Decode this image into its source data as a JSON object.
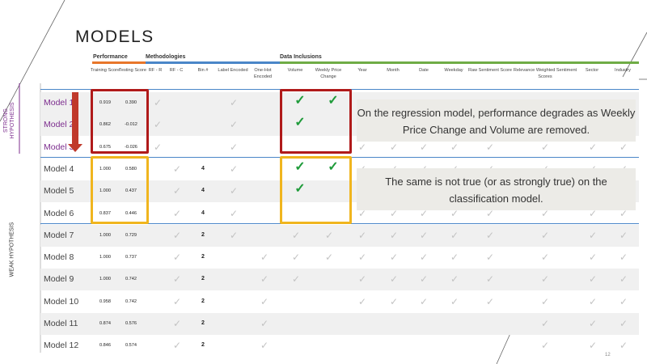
{
  "slide": {
    "title": "MODELS",
    "slide_number": "12",
    "strong_label_line1": "STRONG",
    "strong_label_line2": "HYPOTHESIS",
    "weak_label": "WEAK HYPOTHESIS",
    "callout_top": "On the regression model, performance degrades as Weekly Price Change and Volume are removed.",
    "callout_bottom": "The same is not true (or as strongly true) on the classification model.",
    "colors": {
      "performance": "#e8762b",
      "methodologies": "#4a86c8",
      "data_inclusions": "#6fac46",
      "strong_hypothesis": "#7c2d8e",
      "red_box": "#b01a1a",
      "gold_box": "#f0b51e",
      "green_check": "#1f9b3a",
      "grey_check": "#c3c3c3"
    }
  },
  "groups": {
    "performance": "Performance",
    "methodologies": "Methodologies",
    "data_inclusions": "Data Inclusions"
  },
  "columns": {
    "training_score": "Training Score",
    "testing_score": "Testing Score",
    "rf_r": "RF - R",
    "rf_c": "RF - C",
    "bin": "Bin #",
    "label_encoded": "Label Encoded",
    "onehot_encoded": "One-Hot Encoded",
    "volume": "Volume",
    "weekly_price_change": "Weekly Price Change",
    "year": "Year",
    "month": "Month",
    "date": "Date",
    "weekday": "Weekday",
    "raw_sentiment": "Raw Sentiment Score",
    "relevance_sentiment": "Relevance Weighted Sentiment Scores",
    "sector": "Sector",
    "industry": "Industry"
  },
  "rows": [
    {
      "model": "Model 1",
      "training": "0.919",
      "testing": "0.390",
      "bin": ""
    },
    {
      "model": "Model 2",
      "training": "0.862",
      "testing": "-0.012",
      "bin": ""
    },
    {
      "model": "Model 3",
      "training": "0.675",
      "testing": "-0.026",
      "bin": ""
    },
    {
      "model": "Model 4",
      "training": "1.000",
      "testing": "0.580",
      "bin": "4"
    },
    {
      "model": "Model 5",
      "training": "1.000",
      "testing": "0.437",
      "bin": "4"
    },
    {
      "model": "Model 6",
      "training": "0.837",
      "testing": "0.446",
      "bin": "4"
    },
    {
      "model": "Model 7",
      "training": "1.000",
      "testing": "0.729",
      "bin": "2"
    },
    {
      "model": "Model 8",
      "training": "1.000",
      "testing": "0.737",
      "bin": "2"
    },
    {
      "model": "Model 9",
      "training": "1.000",
      "testing": "0.742",
      "bin": "2"
    },
    {
      "model": "Model 10",
      "training": "0.958",
      "testing": "0.742",
      "bin": "2"
    },
    {
      "model": "Model 11",
      "training": "0.874",
      "testing": "0.576",
      "bin": "2"
    },
    {
      "model": "Model 12",
      "training": "0.846",
      "testing": "0.574",
      "bin": "2"
    }
  ]
}
